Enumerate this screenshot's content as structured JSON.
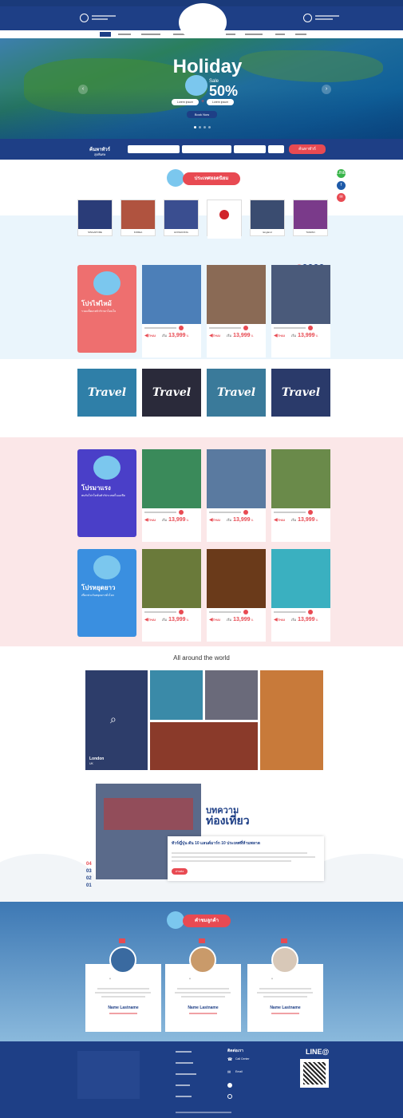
{
  "hero": {
    "title": "Holiday",
    "sale_label": "Sale",
    "percent": "50%",
    "pill_left": "Lorem ipsum",
    "pill_right": "Lorem ipsum",
    "book_label": "Book Now",
    "prev": "‹",
    "next": "›"
  },
  "search": {
    "heading": "ค้นหาทัวร์",
    "subheading": "สุดพิเศษ",
    "button_label": "ค้นหาทัวร์"
  },
  "popular": {
    "title": "ประเทศยอดนิยม",
    "countries": [
      {
        "label": "SINGAPORE",
        "color": "#2a3c78"
      },
      {
        "label": "KOREA",
        "color": "#b0533f"
      },
      {
        "label": "HONGKONG",
        "color": "#3a4e90"
      },
      {
        "label": "",
        "color": "#ffffff"
      },
      {
        "label": "England",
        "color": "#3a4c70"
      },
      {
        "label": "TAIWAN",
        "color": "#7a3a8a"
      }
    ]
  },
  "social": {
    "line": "LINE",
    "facebook": "f",
    "mail": "✉"
  },
  "sections": [
    {
      "promo_title": "โปรไฟไหม้",
      "promo_sub": "รวมแพ็คเกจทัวร์ราคาโดนใจ",
      "bg": "#ee6f6f",
      "cards": [
        {
          "color": "#4c7fb8",
          "flag": "THAI",
          "from": "เริ่ม",
          "price": "13,999",
          "unit": "บ."
        },
        {
          "color": "#8a6a55",
          "flag": "THAI",
          "from": "เริ่ม",
          "price": "13,999",
          "unit": "บ."
        },
        {
          "color": "#4a5a7a",
          "flag": "THAI",
          "from": "เริ่ม",
          "price": "13,999",
          "unit": "บ."
        }
      ]
    },
    {
      "promo_title": "โปรมาแรง",
      "promo_sub": "พบกับโปรโมชั่นทัวร์ประเทศในเอเชีย",
      "bg": "#4a3fc8",
      "cards": [
        {
          "color": "#3a8a5a",
          "flag": "THAI",
          "from": "เริ่ม",
          "price": "13,999",
          "unit": "บ."
        },
        {
          "color": "#5a7aa0",
          "flag": "THAI",
          "from": "เริ่ม",
          "price": "13,999",
          "unit": "บ."
        },
        {
          "color": "#6a8a4a",
          "flag": "THAI",
          "from": "เริ่ม",
          "price": "13,999",
          "unit": "บ."
        }
      ],
      "dots": "1 2 3 4"
    },
    {
      "promo_title": "โปรหยุดยาว",
      "promo_sub": "เที่ยวช่วงวันหยุดยาวทั่วโลก",
      "bg": "#3a8fe0",
      "cards": [
        {
          "color": "#6a7a3a",
          "flag": "THAI",
          "from": "เริ่ม",
          "price": "13,999",
          "unit": "บ."
        },
        {
          "color": "#6a3a1a",
          "flag": "THAI",
          "from": "เริ่ม",
          "price": "13,999",
          "unit": "บ."
        },
        {
          "color": "#3ab0c0",
          "flag": "THAI",
          "from": "เริ่ม",
          "price": "13,999",
          "unit": "บ."
        }
      ]
    }
  ],
  "first_card_color": "#3a5a90",
  "travel_banners": [
    {
      "text": "Travel",
      "color": "#2f7fa8"
    },
    {
      "text": "Travel",
      "color": "#2a2a3a"
    },
    {
      "text": "Travel",
      "color": "#3a7a9a"
    },
    {
      "text": "Travel",
      "color": "#2a3a6a"
    }
  ],
  "around": {
    "title": "All around the world",
    "feature_city": "London",
    "feature_country": "UK"
  },
  "article": {
    "label1": "บทความ",
    "label2": "ท่องเที่ยว",
    "headline": "ทัวร์ญี่ปุ่น ดัน 10 แลนด์มาร์ก 10 ประเทศที่ห้ามพลาด",
    "read_more": "อ่านต่อ",
    "numbers": [
      "04",
      "03",
      "02",
      "01"
    ]
  },
  "reviews": {
    "title": "คำชมลูกค้า",
    "items": [
      {
        "name": "Name Lastname",
        "avatar": "#3a6aa0"
      },
      {
        "name": "Name Lastname",
        "avatar": "#c99a6a"
      },
      {
        "name": "Name Lastname",
        "avatar": "#d8c8b8"
      }
    ]
  },
  "footer": {
    "contact_title": "ติดต่อเรา",
    "call": "Call Center",
    "email": "Email",
    "line_brand": "LINE@"
  }
}
